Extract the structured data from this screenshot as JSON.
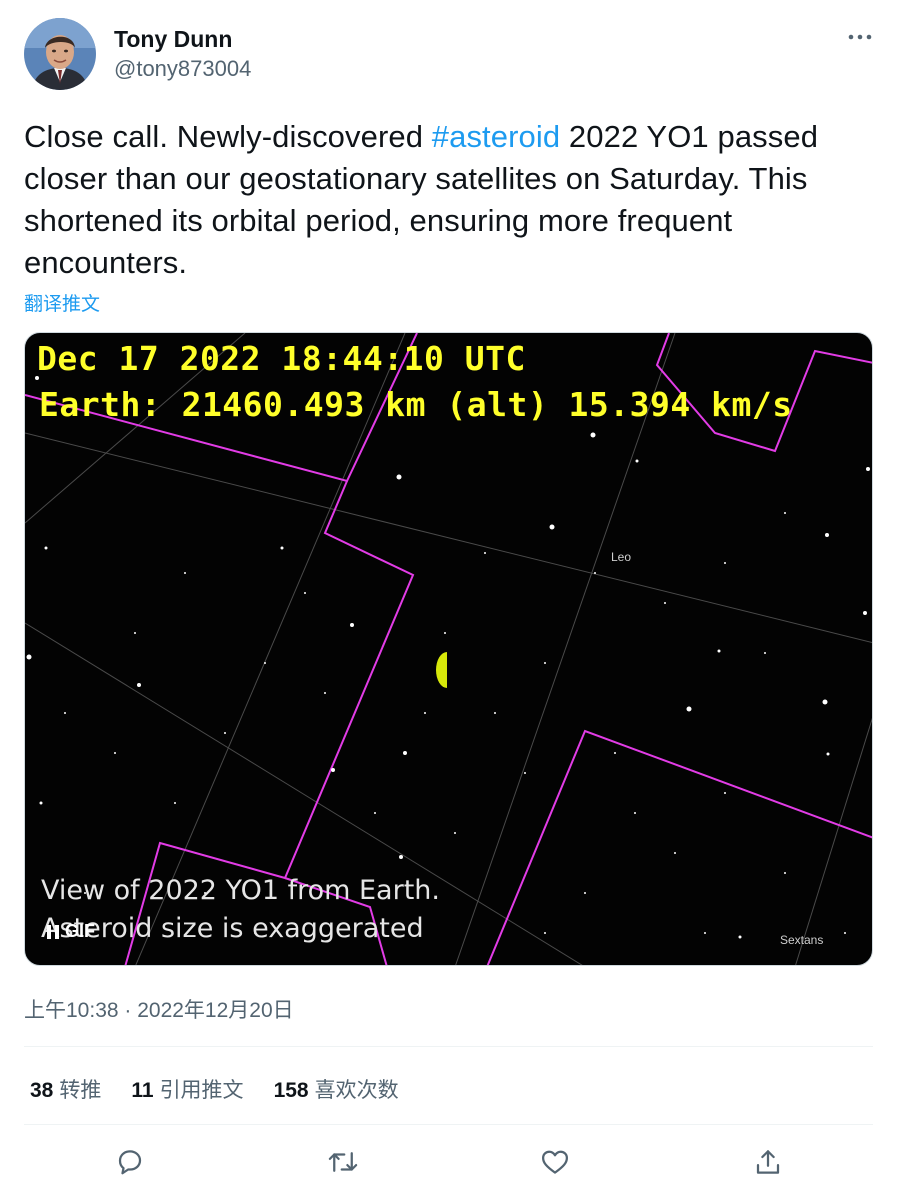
{
  "author": {
    "name": "Tony Dunn",
    "handle": "@tony873004"
  },
  "tweet": {
    "text_before": "Close call. Newly-discovered ",
    "hashtag": "#asteroid",
    "text_after": " 2022 YO1 passed closer than our geostationary satellites on Saturday. This shortened its orbital period, ensuring more frequent encounters.",
    "translate_label": "翻译推文"
  },
  "media": {
    "overlay_line1": "Dec 17 2022 18:44:10 UTC",
    "overlay_line2": "Earth: 21460.493 km (alt) 15.394 km/s",
    "caption_line1": "View of 2022 YO1 from Earth.",
    "caption_line2": "Asteroid size is exaggerated",
    "constellation_leo": "Leo",
    "constellation_sextans": "Sextans",
    "badge_label": "GIF",
    "colors": {
      "overlay_text": "#ffff2a",
      "boundary": "#e23ce6",
      "asteroid": "#d7e80a"
    }
  },
  "meta": {
    "timestamp": "上午10:38 · 2022年12月20日"
  },
  "stats": {
    "retweets_count": "38",
    "retweets_label": "转推",
    "quotes_count": "11",
    "quotes_label": "引用推文",
    "likes_count": "158",
    "likes_label": "喜欢次数"
  },
  "actions": {
    "reply_icon": "reply-icon",
    "retweet_icon": "retweet-icon",
    "like_icon": "like-icon",
    "share_icon": "share-icon"
  },
  "theme": {
    "link": "#1d9bf0",
    "secondary_text": "#536471",
    "primary_text": "#0f1419"
  }
}
